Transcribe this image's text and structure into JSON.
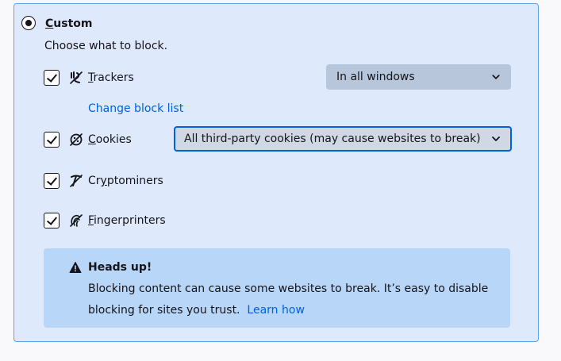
{
  "custom": {
    "label": "Custom",
    "access_key": "C",
    "label_rest": "ustom",
    "selected": true,
    "description": "Choose what to block."
  },
  "trackers": {
    "label_pre": "",
    "access_key": "T",
    "label_rest": "rackers",
    "checked": true,
    "icon": "tracker-icon",
    "scope": "In all windows",
    "change_link": "Change block list"
  },
  "cookies": {
    "label_pre": "",
    "access_key": "C",
    "label_rest": "ookies",
    "checked": true,
    "icon": "cookie-icon",
    "selection": "All third-party cookies (may cause websites to break)"
  },
  "cryptominers": {
    "label_pre": "Cr",
    "access_key": "y",
    "label_rest": "ptominers",
    "checked": true,
    "icon": "cryptominer-icon"
  },
  "fingerprinters": {
    "label_pre": "",
    "access_key": "F",
    "label_rest": "ingerprinters",
    "checked": true,
    "icon": "fingerprinter-icon"
  },
  "notice": {
    "title": "Heads up!",
    "body": "Blocking content can cause some websites to break. It’s easy to disable blocking for sites you trust.",
    "link": "Learn how",
    "icon": "warning-icon"
  },
  "colors": {
    "panel_bg": "#deeafc",
    "panel_border": "#5ba4ee",
    "notice_bg": "#b8d6f7",
    "link": "#0061e0"
  }
}
